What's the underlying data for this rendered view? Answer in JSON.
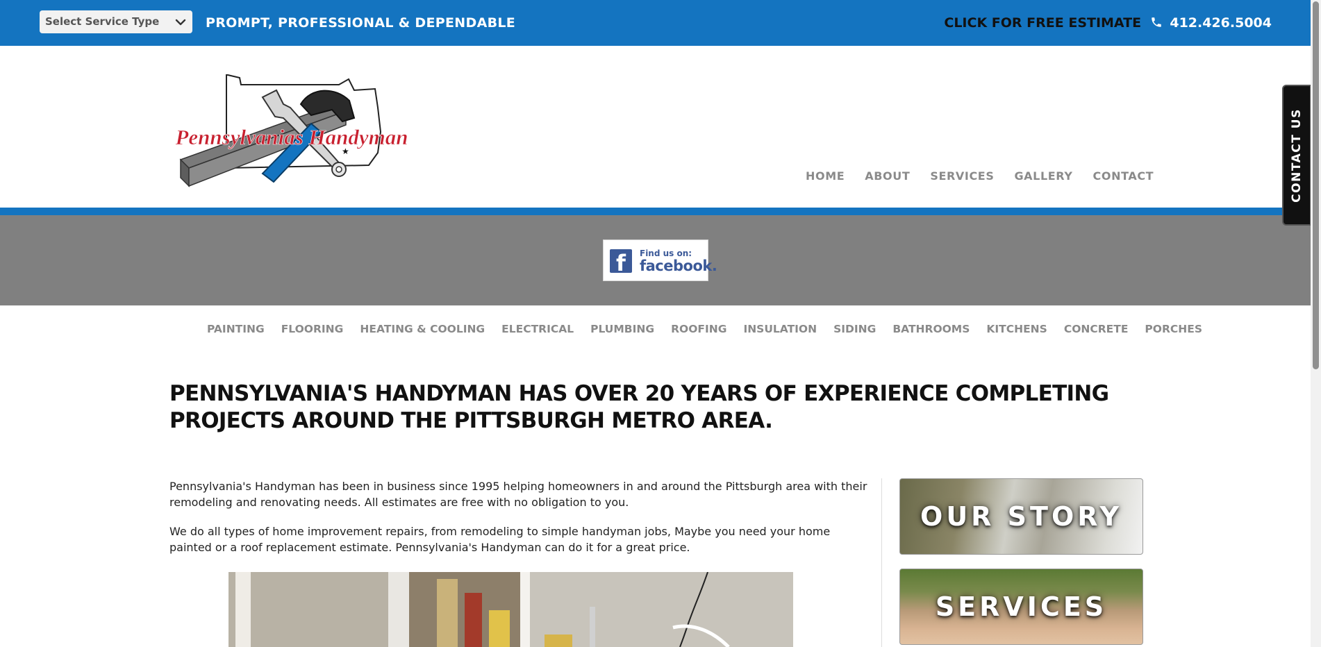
{
  "topbar": {
    "select_label": "Select Service Type",
    "tagline": "PROMPT, PROFESSIONAL & DEPENDABLE",
    "estimate_label": "CLICK FOR FREE ESTIMATE",
    "phone": "412.426.5004",
    "colors": {
      "bar": "#1474c0",
      "estimate_text": "#111111",
      "phone_text": "#ffffff"
    }
  },
  "logo": {
    "text": "Pennsylvanias Handyman"
  },
  "main_nav": {
    "items": [
      {
        "label": "HOME"
      },
      {
        "label": "ABOUT"
      },
      {
        "label": "SERVICES"
      },
      {
        "label": "GALLERY"
      },
      {
        "label": "CONTACT"
      }
    ]
  },
  "facebook_badge": {
    "small": "Find us on:",
    "big": "facebook."
  },
  "contact_tab": {
    "label": "CONTACT US"
  },
  "service_nav": {
    "items": [
      {
        "label": "PAINTING"
      },
      {
        "label": "FLOORING"
      },
      {
        "label": "HEATING & COOLING"
      },
      {
        "label": "ELECTRICAL"
      },
      {
        "label": "PLUMBING"
      },
      {
        "label": "ROOFING"
      },
      {
        "label": "INSULATION"
      },
      {
        "label": "SIDING"
      },
      {
        "label": "BATHROOMS"
      },
      {
        "label": "KITCHENS"
      },
      {
        "label": "CONCRETE"
      },
      {
        "label": "PORCHES"
      }
    ]
  },
  "content": {
    "headline": "PENNSYLVANIA'S HANDYMAN HAS OVER 20 YEARS OF EXPERIENCE COMPLETING PROJECTS AROUND THE PITTSBURGH METRO AREA.",
    "paragraph_1": "Pennsylvania's Handyman has been in business since 1995 helping homeowners in and around the Pittsburgh area with their remodeling and renovating needs. All estimates are free with no obligation to you.",
    "paragraph_2": "We do all types of home improvement repairs, from remodeling to simple handyman jobs, Maybe you need your home painted or a roof replacement estimate. Pennsylvania's Handyman can do it for a great price."
  },
  "sidebar": {
    "cta_1": "OUR STORY",
    "cta_2": "SERVICES"
  }
}
